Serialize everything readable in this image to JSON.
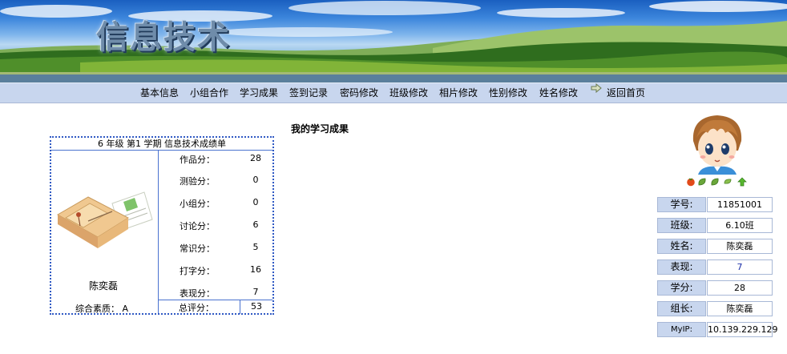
{
  "banner": {
    "title": "信息技术"
  },
  "nav": {
    "items": [
      "基本信息",
      "小组合作",
      "学习成果",
      "签到记录",
      "密码修改",
      "班级修改",
      "相片修改",
      "性别修改",
      "姓名修改"
    ],
    "home": "返回首页",
    "home_icon": "arrow-right-icon"
  },
  "section_title": "我的学习成果",
  "score_card": {
    "title": "6 年级 第1 学期 信息技术成绩单",
    "student_name": "陈奕磊",
    "quality": "综合素质： A",
    "rows": [
      {
        "label": "作品分：",
        "value": "28"
      },
      {
        "label": "测验分：",
        "value": "0"
      },
      {
        "label": "小组分：",
        "value": "0"
      },
      {
        "label": "讨论分：",
        "value": "6"
      },
      {
        "label": "常识分：",
        "value": "5"
      },
      {
        "label": "打字分：",
        "value": "16"
      },
      {
        "label": "表现分：",
        "value": "7"
      }
    ],
    "total_label": "总评分：",
    "total_value": "53"
  },
  "profile": {
    "badges": [
      "tomato-icon",
      "leaf-icon",
      "leaf-icon",
      "leaf-icon",
      "up-arrow-icon"
    ],
    "fields": [
      {
        "label": "学号:",
        "value": "11851001"
      },
      {
        "label": "班级:",
        "value": "6.10班"
      },
      {
        "label": "姓名:",
        "value": "陈奕磊"
      },
      {
        "label": "表现:",
        "value": "7"
      },
      {
        "label": "学分:",
        "value": "28"
      },
      {
        "label": "组长:",
        "value": "陈奕磊"
      },
      {
        "label": "MyIP:",
        "value": "10.139.229.129"
      }
    ]
  }
}
